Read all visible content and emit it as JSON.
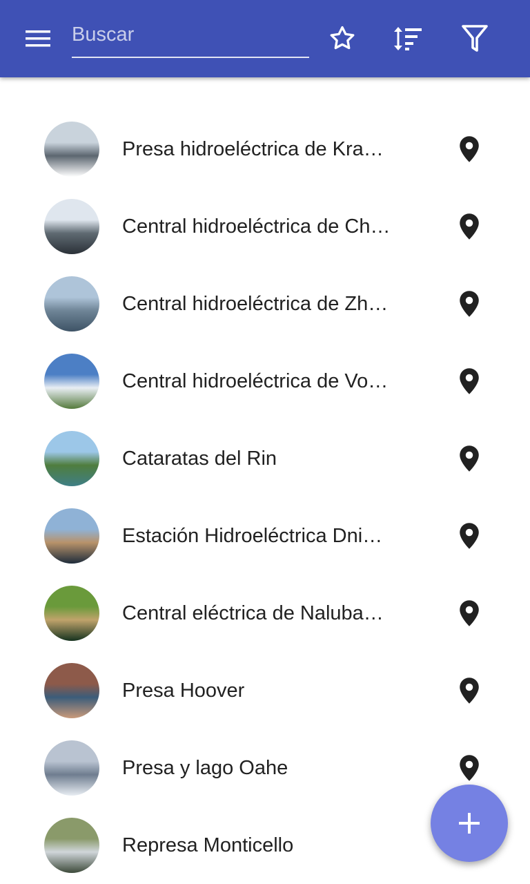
{
  "appbar": {
    "background": "#3f51b5",
    "menu_icon": "menu-icon",
    "search": {
      "placeholder": "Buscar",
      "value": ""
    },
    "actions": [
      "star-icon",
      "sort-icon",
      "filter-icon"
    ]
  },
  "list": {
    "items": [
      {
        "label": "Presa hidroeléctrica de Kra…",
        "thumb_colors": [
          "#c9d3dc",
          "#5c6670",
          "#ffffff"
        ]
      },
      {
        "label": "Central hidroeléctrica de Ch…",
        "thumb_colors": [
          "#dfe6ee",
          "#5f6a72",
          "#2b3138"
        ]
      },
      {
        "label": "Central hidroeléctrica de Zh…",
        "thumb_colors": [
          "#aec4d9",
          "#6f8597",
          "#3e5366"
        ]
      },
      {
        "label": "Central hidroeléctrica de Vo…",
        "thumb_colors": [
          "#4c7fc5",
          "#e9eef4",
          "#557a3c"
        ]
      },
      {
        "label": "Cataratas del Rin",
        "thumb_colors": [
          "#9cc7e8",
          "#4f7d3e",
          "#3f7f86"
        ]
      },
      {
        "label": "Estación Hidroeléctrica Dni…",
        "thumb_colors": [
          "#8fb2d6",
          "#b8926a",
          "#1e2c3b"
        ]
      },
      {
        "label": "Central eléctrica de Naluba…",
        "thumb_colors": [
          "#6a9a3b",
          "#c0a36b",
          "#16331f"
        ]
      },
      {
        "label": "Presa Hoover",
        "thumb_colors": [
          "#8d5a4a",
          "#3b5c7a",
          "#c99a7a"
        ]
      },
      {
        "label": "Presa y lago Oahe",
        "thumb_colors": [
          "#b9c3d1",
          "#6f7d8f",
          "#e8edf3"
        ]
      },
      {
        "label": "Represa Monticello",
        "thumb_colors": [
          "#8a9a6a",
          "#d0d6da",
          "#3d4a3a"
        ]
      }
    ],
    "pin_icon": "location-pin-icon"
  },
  "fab": {
    "icon": "plus-icon",
    "color": "#7581e3"
  }
}
